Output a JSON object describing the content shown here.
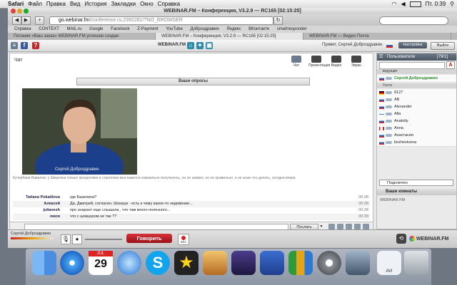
{
  "menubar": {
    "apple": "",
    "app": "Safari",
    "items": [
      "Файл",
      "Правка",
      "Вид",
      "История",
      "Закладки",
      "Окно",
      "Справка"
    ],
    "clock": "Пт. 0:39"
  },
  "window": {
    "title": "WEBINAR.FM – Конференция, V3.2.9 — RC165 [02:15:25]",
    "url_domain": "go.webinar.fm",
    "url_rest": "/conference.ru.2392281/?NO_BROWSER",
    "bookmarks": [
      "Справка",
      "CONTEXT",
      "MAIL.ru",
      "Google",
      "Facebook",
      "Z-Payment",
      "YouTube",
      "Доброздравин",
      "Яндекс",
      "ВКонтакте",
      "smartresponder"
    ],
    "tabs": [
      {
        "label": "Питание «Ваш заказ» WEBINAR.FM успешно создан",
        "active": false
      },
      {
        "label": "WEBINAR.FM – Конференция, V3.2.9 — RC165 [02:15:25]",
        "active": true
      },
      {
        "label": "WEBINAR.FM — Видео Почта",
        "active": false
      }
    ]
  },
  "webinar": {
    "brand": "WEBINAR.FM",
    "greeting": "Привет, Сергей Доброздравин",
    "settings_label": "Настройки",
    "exit_label": "Выйти",
    "chat_label": "Чат",
    "modes": [
      "Чат",
      "Презентация",
      "Видео",
      "Экран"
    ],
    "polls_label": "Ваши опросы",
    "video_label": "Сергей Доброздравин",
    "broadcast": "Кучербаев Вавилов: у Шмыгина только процентики и стрелочки мне кажется нормально получилось, он не заявил, но не правильно. я не знаю что делать, сегодня вчера",
    "messages": [
      {
        "name": "Tatiana Pokatilova",
        "text": "где Базилина?",
        "time": "00:38"
      },
      {
        "name": "Алексей",
        "text": "Да, Дмитрей, согласен. Шокшук - есть к чему какое-то недовение...",
        "time": "00:38"
      },
      {
        "name": "juliavesh",
        "text": "про энарант еще слышала , что там много полезного...",
        "time": "00:38"
      },
      {
        "name": "люся",
        "text": "что с шокшуком не так ??",
        "time": "00:39"
      }
    ],
    "send_label": "Послать",
    "users": {
      "title": "Пользователи",
      "count": "[79/1]",
      "group_leaders": "ведущие",
      "leader": "Сергей Доброздравин",
      "group_guests": "Гости",
      "list": [
        "8127",
        "AB",
        "Alexander",
        "Alla",
        "Anatoliy",
        "Anna",
        "Анастасия",
        "bozhestvena"
      ],
      "connected": "Подключен",
      "rooms_title": "Ваши комнаты",
      "room": "WEBINAR.FM"
    },
    "bottom": {
      "user": "Сергей Доброздравин",
      "speak_label": "Говорить",
      "rec_label": "REC",
      "logo": "WEBINAR.FM"
    }
  },
  "dock": {
    "calendar_month": "JUL",
    "calendar_day": "29",
    "avi_label": "AVI"
  },
  "colors": {
    "accent": "#4a5563",
    "speak": "#b0191e",
    "leader": "#2a8c2a"
  }
}
